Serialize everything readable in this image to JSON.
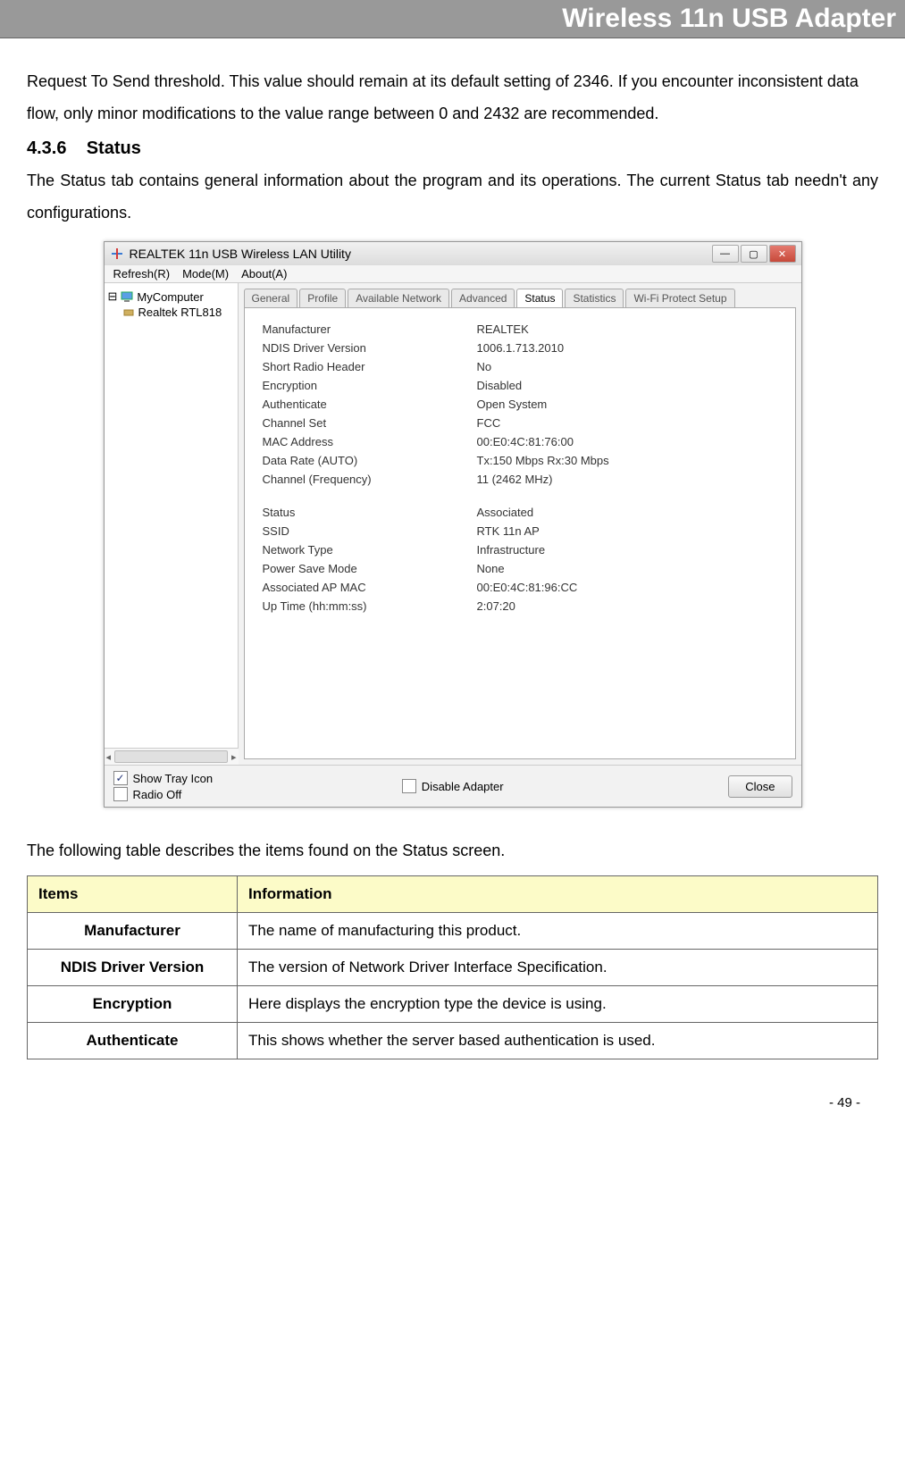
{
  "header": {
    "title": "Wireless 11n USB Adapter"
  },
  "intro": "Request To Send threshold. This value should remain at its default setting of 2346. If you encounter inconsistent data flow, only minor modifications to the value range between 0 and 2432 are recommended.",
  "section": {
    "number": "4.3.6",
    "title": "Status",
    "body": "The Status tab contains general information about the program and its operations. The current Status tab needn't any configurations."
  },
  "screenshot": {
    "window_title": "REALTEK 11n USB Wireless LAN Utility",
    "menus": [
      "Refresh(R)",
      "Mode(M)",
      "About(A)"
    ],
    "tree": {
      "root": "MyComputer",
      "child": "Realtek RTL818"
    },
    "tabs": [
      "General",
      "Profile",
      "Available Network",
      "Advanced",
      "Status",
      "Statistics",
      "Wi-Fi Protect Setup"
    ],
    "active_tab_index": 4,
    "status_rows_a": [
      {
        "label": "Manufacturer",
        "value": "REALTEK"
      },
      {
        "label": "NDIS Driver Version",
        "value": "1006.1.713.2010"
      },
      {
        "label": "Short Radio Header",
        "value": "No"
      },
      {
        "label": "Encryption",
        "value": "Disabled"
      },
      {
        "label": "Authenticate",
        "value": "Open System"
      },
      {
        "label": "Channel Set",
        "value": "FCC"
      },
      {
        "label": "MAC Address",
        "value": "00:E0:4C:81:76:00"
      },
      {
        "label": "Data Rate (AUTO)",
        "value": "Tx:150 Mbps Rx:30 Mbps"
      },
      {
        "label": "Channel (Frequency)",
        "value": "11 (2462 MHz)"
      }
    ],
    "status_rows_b": [
      {
        "label": "Status",
        "value": "Associated"
      },
      {
        "label": "SSID",
        "value": "RTK 11n AP"
      },
      {
        "label": "Network Type",
        "value": "Infrastructure"
      },
      {
        "label": "Power Save Mode",
        "value": "None"
      },
      {
        "label": "Associated AP MAC",
        "value": "00:E0:4C:81:96:CC"
      },
      {
        "label": "Up Time (hh:mm:ss)",
        "value": "2:07:20"
      }
    ],
    "bottom": {
      "show_tray": {
        "label": "Show Tray Icon",
        "checked": true
      },
      "radio_off": {
        "label": "Radio Off",
        "checked": false
      },
      "disable_adapter": {
        "label": "Disable Adapter",
        "checked": false
      },
      "close": "Close"
    }
  },
  "table_intro": "The following table describes the items found on the Status screen.",
  "table": {
    "headers": [
      "Items",
      "Information"
    ],
    "rows": [
      {
        "item": "Manufacturer",
        "info": "The name of manufacturing this product."
      },
      {
        "item": "NDIS Driver Version",
        "info": "The version of Network Driver Interface Specification."
      },
      {
        "item": "Encryption",
        "info": "Here displays the encryption type the device is using."
      },
      {
        "item": "Authenticate",
        "info": "This shows whether the server based authentication is used."
      }
    ]
  },
  "page_number": "- 49 -"
}
